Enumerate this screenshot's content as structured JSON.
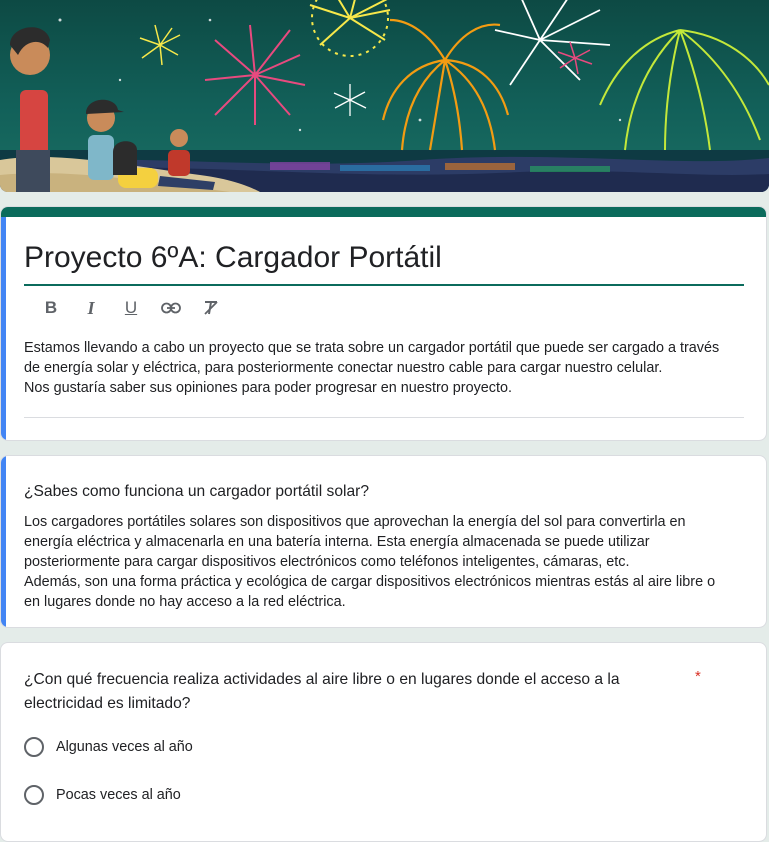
{
  "banner": {
    "image": "fireworks-beach-illustration"
  },
  "form": {
    "title": "Proyecto 6ºA: Cargador Portátil",
    "toolbar": {
      "bold_label": "B",
      "italic_label": "I",
      "underline_label": "U",
      "link_icon": "link-icon",
      "clear_format_icon": "clear-format-icon"
    },
    "description_lines": [
      "Estamos llevando a cabo un proyecto que se trata sobre un cargador portátil que puede ser cargado a través",
      "de energía solar y eléctrica, para posteriormente conectar nuestro cable para cargar nuestro celular.",
      "Nos gustaría saber sus opiniones para poder progresar en nuestro proyecto."
    ]
  },
  "info_section": {
    "title": "¿Sabes como funciona un cargador portátil solar?",
    "body_lines": [
      "Los cargadores portátiles solares son dispositivos que aprovechan la energía del sol para convertirla en",
      "energía eléctrica y almacenarla en una batería interna. Esta energía almacenada se puede utilizar",
      "posteriormente para cargar dispositivos electrónicos como teléfonos inteligentes, cámaras, etc.",
      "Además, son una forma práctica y ecológica de cargar dispositivos electrónicos mientras estás al aire libre o",
      "en lugares donde no hay acceso a la red eléctrica."
    ]
  },
  "question": {
    "title_lines": [
      "¿Con qué frecuencia realiza actividades al aire libre o en lugares donde el acceso a la",
      "electricidad es limitado?"
    ],
    "required_mark": "*",
    "options": [
      "Algunas veces al año",
      "Pocas veces al año"
    ]
  },
  "colors": {
    "theme": "#0b6b5c",
    "accent_left_bar": "#4285f4",
    "required": "#d93025",
    "background": "#e4ece9"
  }
}
